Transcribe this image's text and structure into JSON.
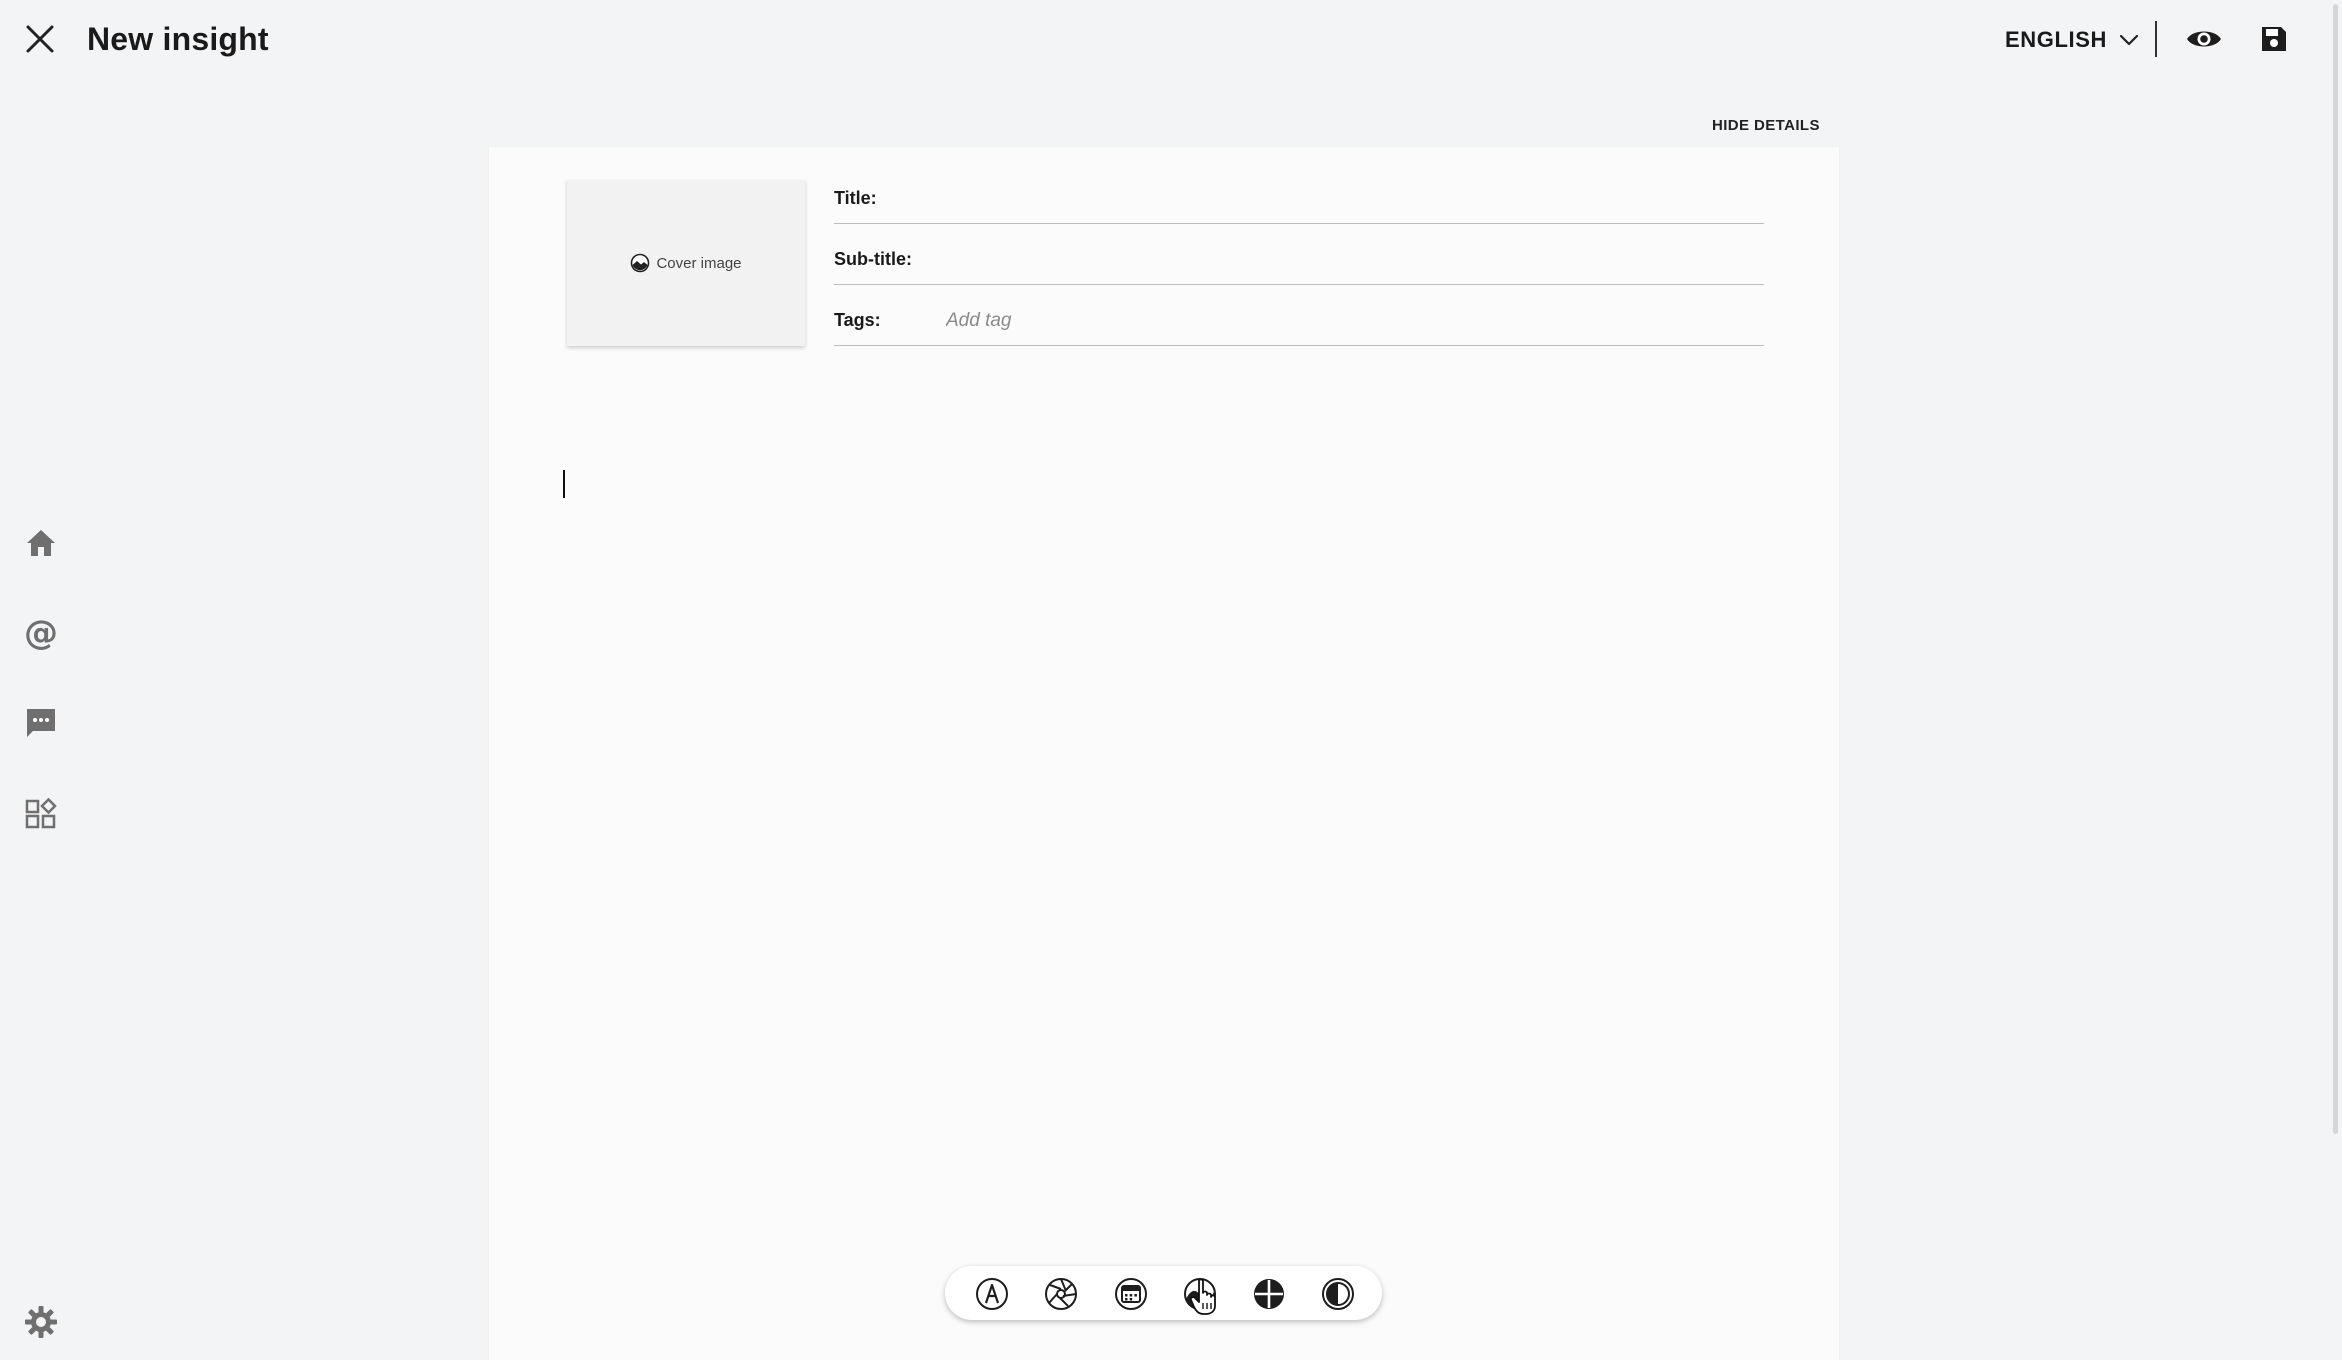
{
  "header": {
    "title": "New insight",
    "language": "ENGLISH"
  },
  "icons": {
    "close": "close-icon",
    "language_dropdown": "chevron-down-icon",
    "preview": "eye-icon",
    "save": "floppy-disk-icon"
  },
  "sidebar": {
    "items": [
      {
        "name": "home",
        "icon": "home-icon"
      },
      {
        "name": "mentions",
        "icon": "at-sign-icon"
      },
      {
        "name": "messages",
        "icon": "chat-bubble-icon"
      },
      {
        "name": "apps",
        "icon": "widgets-icon"
      }
    ],
    "settings_icon": "gear-icon"
  },
  "details": {
    "toggle_label": "HIDE DETAILS",
    "cover_image_label": "Cover image",
    "title_label": "Title:",
    "title_value": "",
    "subtitle_label": "Sub-title:",
    "subtitle_value": "",
    "tags_label": "Tags:",
    "tags_placeholder": "Add tag"
  },
  "toolbar": {
    "tools": [
      {
        "name": "text-block",
        "icon": "text-a-icon"
      },
      {
        "name": "media-block",
        "icon": "aperture-icon"
      },
      {
        "name": "calendar-block",
        "icon": "calendar-icon"
      },
      {
        "name": "chart-block",
        "icon": "chart-icon"
      },
      {
        "name": "add-block",
        "icon": "plus-circle-icon"
      },
      {
        "name": "contrast-block",
        "icon": "contrast-icon"
      }
    ]
  },
  "colors": {
    "background": "#f3f4f5",
    "card": "#fbfbfb",
    "text": "#1a1a1a",
    "muted_icon": "#6f6f6f"
  }
}
